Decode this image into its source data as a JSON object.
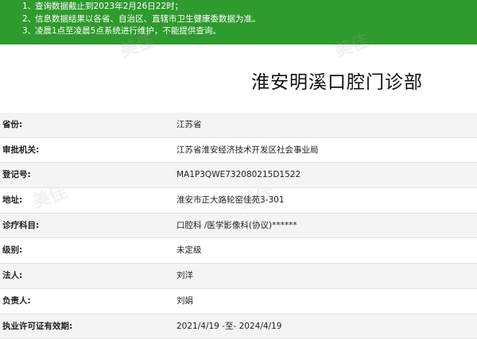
{
  "notice": {
    "lines": [
      {
        "num": "1、",
        "text": "查询数据截止到2023年2月26日22时；"
      },
      {
        "num": "2、",
        "text": "信息数据结果以各省、自治区、直辖市卫生健康委数据为准。"
      },
      {
        "num": "3、",
        "text": "凌晨1点至凌晨5点系统进行维护，不能提供查询。"
      }
    ]
  },
  "title": "淮安明溪口腔门诊部",
  "rows": [
    {
      "label": "省份:",
      "value": "江苏省"
    },
    {
      "label": "审批机关:",
      "value": "江苏省淮安经济技术开发区社会事业局"
    },
    {
      "label": "登记号:",
      "value": "MA1P3QWE732080215D1522"
    },
    {
      "label": "地址:",
      "value": "淮安市正大路轮窑佳苑3-301"
    },
    {
      "label": "诊疗科目:",
      "value": "口腔科 /医学影像科(协议)******"
    },
    {
      "label": "级别:",
      "value": "未定级"
    },
    {
      "label": "法人:",
      "value": "刘洋"
    },
    {
      "label": "负责人:",
      "value": "刘娟"
    },
    {
      "label": "执业许可证有效期:",
      "value": "2021/4/19 -至- 2024/4/19"
    }
  ],
  "watermark": "美佳"
}
